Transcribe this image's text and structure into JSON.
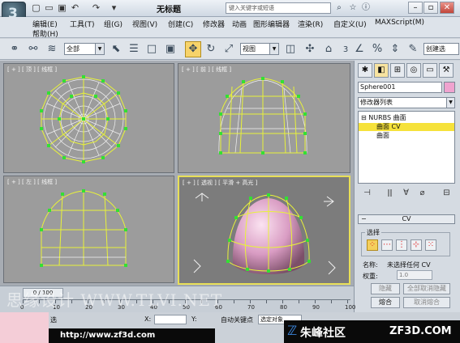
{
  "title_bar": {
    "app_logo": "3dsmax-logo",
    "document_title": "无标题",
    "search_placeholder": "键入关键字或短语",
    "icons": [
      "new-icon",
      "open-icon",
      "save-icon",
      "undo-icon",
      "redo-icon",
      "binoculars-icon",
      "star-icon",
      "info-icon"
    ]
  },
  "menu": {
    "items": [
      "编辑(E)",
      "工具(T)",
      "组(G)",
      "视图(V)",
      "创建(C)",
      "修改器",
      "动画",
      "图形编辑器",
      "渲染(R)",
      "自定义(U)",
      "MAXScript(M)",
      "帮助(H)"
    ]
  },
  "toolbar": {
    "selection_filter": "全部",
    "ref_coord": "视图",
    "spinner_value": "3",
    "named_selection": "创建选"
  },
  "viewports": [
    {
      "label": "[ + ] [ 顶 ] [ 线框 ]",
      "name": "top"
    },
    {
      "label": "[ + ] [ 前 ] [ 线框 ]",
      "name": "front"
    },
    {
      "label": "[ + ] [ 左 ] [ 线框 ]",
      "name": "left"
    },
    {
      "label": "[ + ] [ 透视 ] [ 平滑 + 高光 ]",
      "name": "perspective"
    }
  ],
  "command_panel": {
    "object_name": "Sphere001",
    "object_color": "#f0a3cf",
    "modifier_list": "修改器列表",
    "stack": [
      {
        "label": "⊟ NURBS 曲面",
        "selected": false
      },
      {
        "label": "曲面 CV",
        "selected": true
      },
      {
        "label": "曲面",
        "selected": false
      }
    ],
    "rollout_title": "CV",
    "selection_group": "选择",
    "name_label": "名称:",
    "name_value": "未选择任何 CV",
    "weight_label": "权重:",
    "weight_value": "1.0",
    "btn_hide": "隐藏",
    "btn_unhide_all": "全部取消隐藏",
    "btn_fuse": "熔合",
    "btn_unfuse": "取消熔合"
  },
  "timeline": {
    "frame_display": "0 / 100",
    "ticks": [
      "0",
      "5",
      "10",
      "15",
      "20",
      "25",
      "30",
      "35",
      "40",
      "45",
      "50",
      "55",
      "60",
      "65",
      "70",
      "75",
      "80",
      "85",
      "90",
      "95",
      "100"
    ]
  },
  "status": {
    "select_label": "选",
    "x_label": "X:",
    "y_label": "Y:",
    "auto_key": "自动关键点",
    "selected_dropdown": "选定对象"
  },
  "footer": {
    "url": "http://www.zf3d.com",
    "community": "朱峰社区",
    "site": "ZF3D.COM"
  },
  "watermark": "思缘设计 WWW.TLVI.NET",
  "accent_color": "#f6e23a"
}
